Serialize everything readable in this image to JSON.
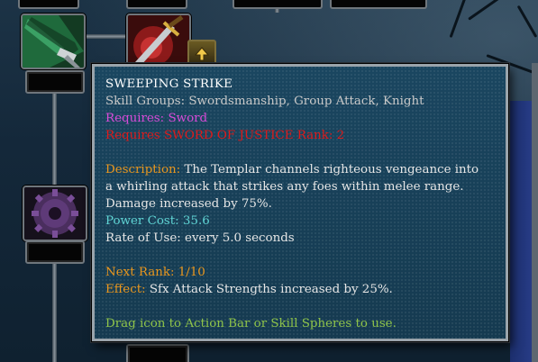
{
  "colors": {
    "title": "#ffffff",
    "groups": "#c9c9c9",
    "requires_item": "#d94bd9",
    "requires_rank": "#e01a1a",
    "label_orange": "#e8961e",
    "power_cost": "#5fd4d4",
    "body": "#e6e6e6",
    "hint": "#8fc44a",
    "frame": "#9aa4ab",
    "panel": "#173f56"
  },
  "icons": {
    "skill_sweeping_strike": "sweeping-strike-skill-icon",
    "skill_sword": "sword-skill-icon",
    "rank_up": "rank-up-arrow-icon",
    "skill_gear": "gear-skill-icon"
  },
  "tooltip": {
    "title": "SWEEPING STRIKE",
    "skill_groups": "Skill Groups: Swordsmanship, Group Attack, Knight",
    "requires_item": "Requires: Sword",
    "requires_rank": "Requires SWORD OF JUSTICE Rank: 2",
    "description_label": "Description:",
    "description_lines": [
      " The Templar channels righteous vengeance into",
      "a whirling attack that strikes any foes within melee range.",
      "Damage increased by 75%."
    ],
    "power_cost": "Power Cost: 35.6",
    "rate_of_use": "Rate of Use: every 5.0 seconds",
    "next_rank_label": "Next Rank:",
    "next_rank_value": " 1/10",
    "effect_label": "Effect:",
    "effect_value": " Sfx Attack Strengths increased by 25%.",
    "hint": "Drag icon to Action Bar or Skill Spheres to use."
  }
}
